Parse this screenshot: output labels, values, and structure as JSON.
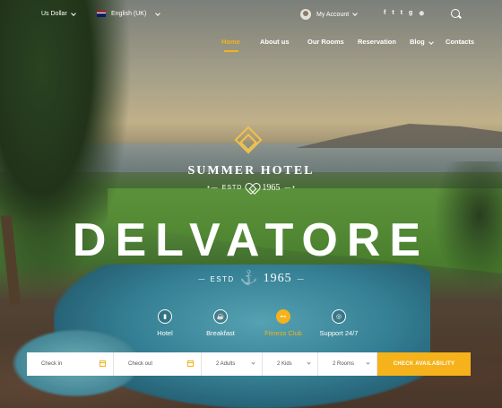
{
  "topbar": {
    "currency": "Us Dollar",
    "language": "English (UK)",
    "account": "My Account",
    "social": [
      {
        "icon": "facebook-icon",
        "glyph": "f"
      },
      {
        "icon": "twitter-icon",
        "glyph": "t"
      },
      {
        "icon": "tumblr-icon",
        "glyph": "t"
      },
      {
        "icon": "google-plus-icon",
        "glyph": "g"
      },
      {
        "icon": "dribbble-icon",
        "glyph": "⊕"
      }
    ]
  },
  "nav": {
    "items": [
      "Home",
      "About us",
      "Our Rooms",
      "Reservation",
      "Blog",
      "Contacts"
    ],
    "active": "Home"
  },
  "hero": {
    "subtitle": "SUMMER HOTEL",
    "estd_label": "ESTD",
    "estd_year": "1965",
    "title": "DELVATORE",
    "estd2_label": "ESTD",
    "estd2_year": "1965"
  },
  "features": [
    {
      "label": "Hotel",
      "icon": "hotel-icon",
      "active": false
    },
    {
      "label": "Breakfast",
      "icon": "coffee-icon",
      "active": false
    },
    {
      "label": "Fitness Club",
      "icon": "dumbbell-icon",
      "active": true
    },
    {
      "label": "Support 24/7",
      "icon": "support-icon",
      "active": false
    }
  ],
  "booking": {
    "check_in": "Check in",
    "check_out": "Check out",
    "adults": "2 Adults",
    "kids": "2 Kids",
    "rooms": "2 Rooms",
    "button": "CHECK AVAILABILITY"
  },
  "colors": {
    "accent": "#f5b21a",
    "text_light": "#ffffff"
  }
}
